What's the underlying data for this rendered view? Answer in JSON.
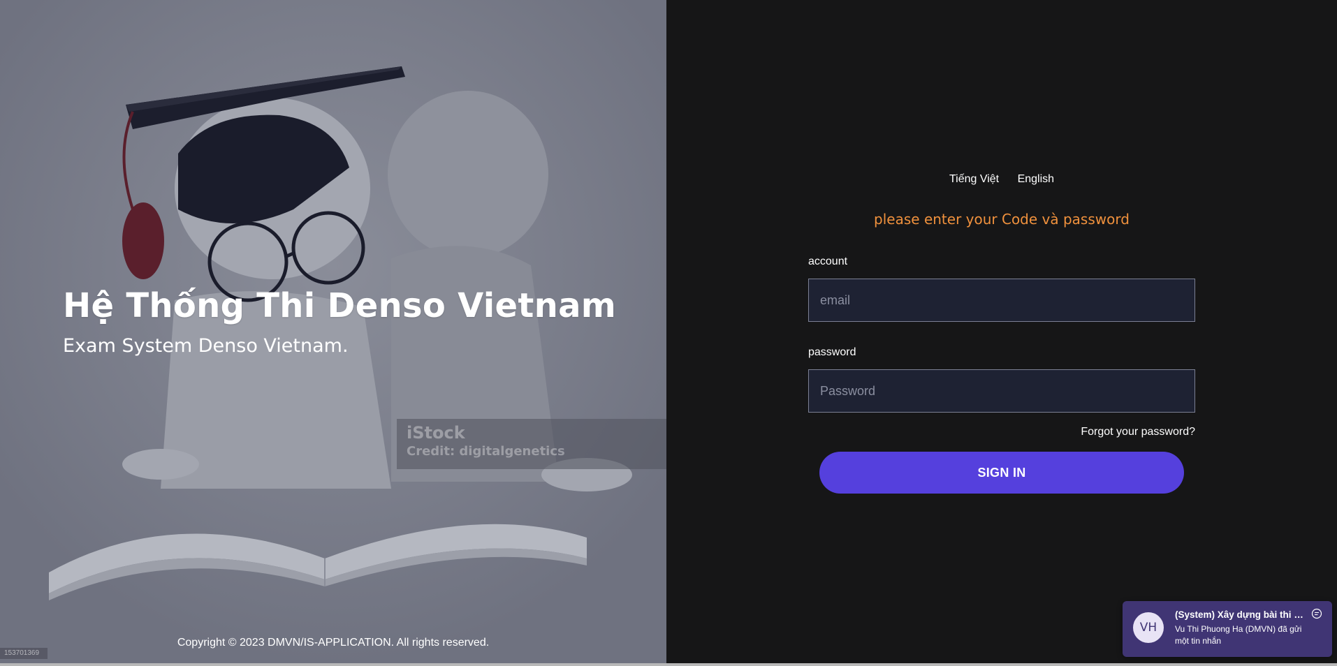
{
  "hero": {
    "title": "Hệ Thống Thi Denso Vietnam",
    "subtitle": "Exam System Denso Vietnam.",
    "watermark": {
      "brand": "iStock",
      "credit": "Credit: digitalgenetics"
    },
    "image_id": "153701369",
    "copyright": "Copyright © 2023 DMVN/IS-APPLICATION. All rights reserved."
  },
  "login": {
    "languages": [
      "Tiếng Việt",
      "English"
    ],
    "prompt": "please enter your Code và password",
    "account_label": "account",
    "account_placeholder": "email",
    "password_label": "password",
    "password_placeholder": "Password",
    "forgot_label": "Forgot your password?",
    "signin_label": "SIGN IN"
  },
  "toast": {
    "avatar_initials": "VH",
    "title": "(System) Xây dựng bài thi sk...",
    "body": "Vu Thi Phuong Ha (DMVN) đã gửi một tin nhắn",
    "icon": "chat-bubble-icon"
  },
  "colors": {
    "accent": "#5540dd",
    "prompt": "#f0913d",
    "panel_bg": "#161617",
    "input_bg": "#1e2233",
    "hero_bg": "#7a7d8a",
    "toast_bg": "#403574"
  }
}
